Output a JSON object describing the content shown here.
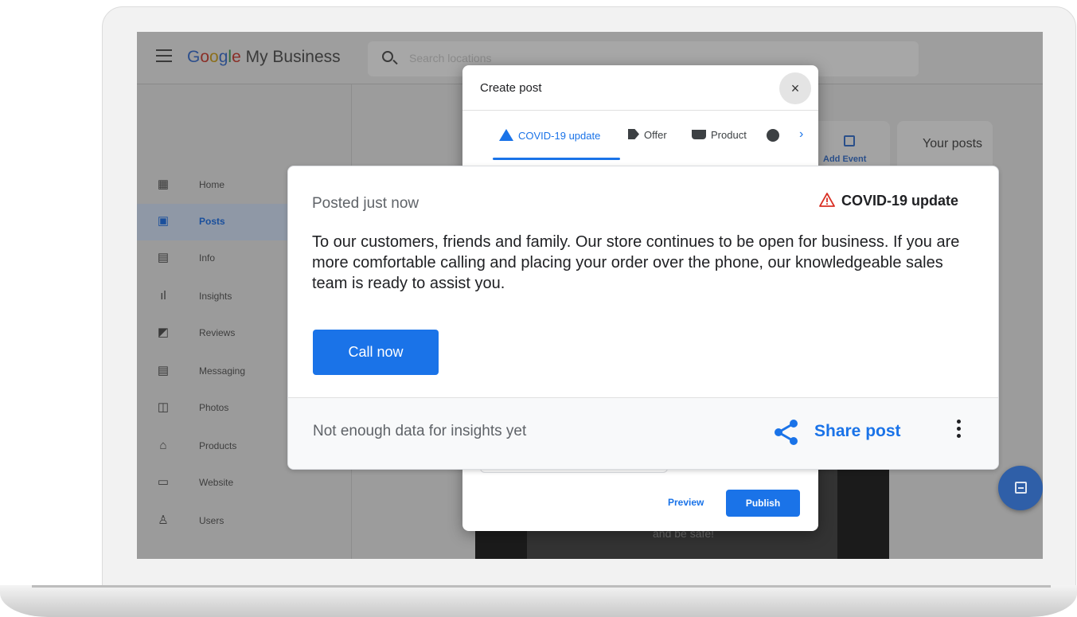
{
  "app": {
    "logo_google": [
      "G",
      "o",
      "o",
      "g",
      "l",
      "e"
    ],
    "logo_suffix": " My Business",
    "search_placeholder": "Search locations"
  },
  "sidebar": {
    "items": [
      {
        "label": "Home",
        "icon": "home-icon"
      },
      {
        "label": "Posts",
        "icon": "posts-icon",
        "active": true
      },
      {
        "label": "Info",
        "icon": "info-icon"
      },
      {
        "label": "Insights",
        "icon": "insights-icon"
      },
      {
        "label": "Reviews",
        "icon": "reviews-icon"
      },
      {
        "label": "Messaging",
        "icon": "messaging-icon"
      },
      {
        "label": "Photos",
        "icon": "photos-icon"
      },
      {
        "label": "Products",
        "icon": "products-icon"
      },
      {
        "label": "Website",
        "icon": "website-icon"
      },
      {
        "label": "Users",
        "icon": "users-icon"
      }
    ]
  },
  "background": {
    "add_event_label": "Add Event",
    "your_posts_label": "Your posts",
    "dark_caption": "and be safe!"
  },
  "dialog": {
    "title": "Create post",
    "close_glyph": "×",
    "tabs": [
      {
        "label": "COVID-19 update",
        "active": true
      },
      {
        "label": "Offer"
      },
      {
        "label": "Product"
      }
    ],
    "preview_label": "Preview",
    "publish_label": "Publish"
  },
  "post_card": {
    "posted_status": "Posted just now",
    "badge_label": "COVID-19 update",
    "body": "To our customers, friends and family. Our store continues to be open for business. If you are more comfortable calling and placing your order over the phone, our knowledgeable sales team is ready to assist you.",
    "cta_label": "Call now",
    "insights_text": "Not enough data for insights yet",
    "share_label": "Share post"
  },
  "colors": {
    "accent": "#1a73e8",
    "warning": "#d93025"
  }
}
